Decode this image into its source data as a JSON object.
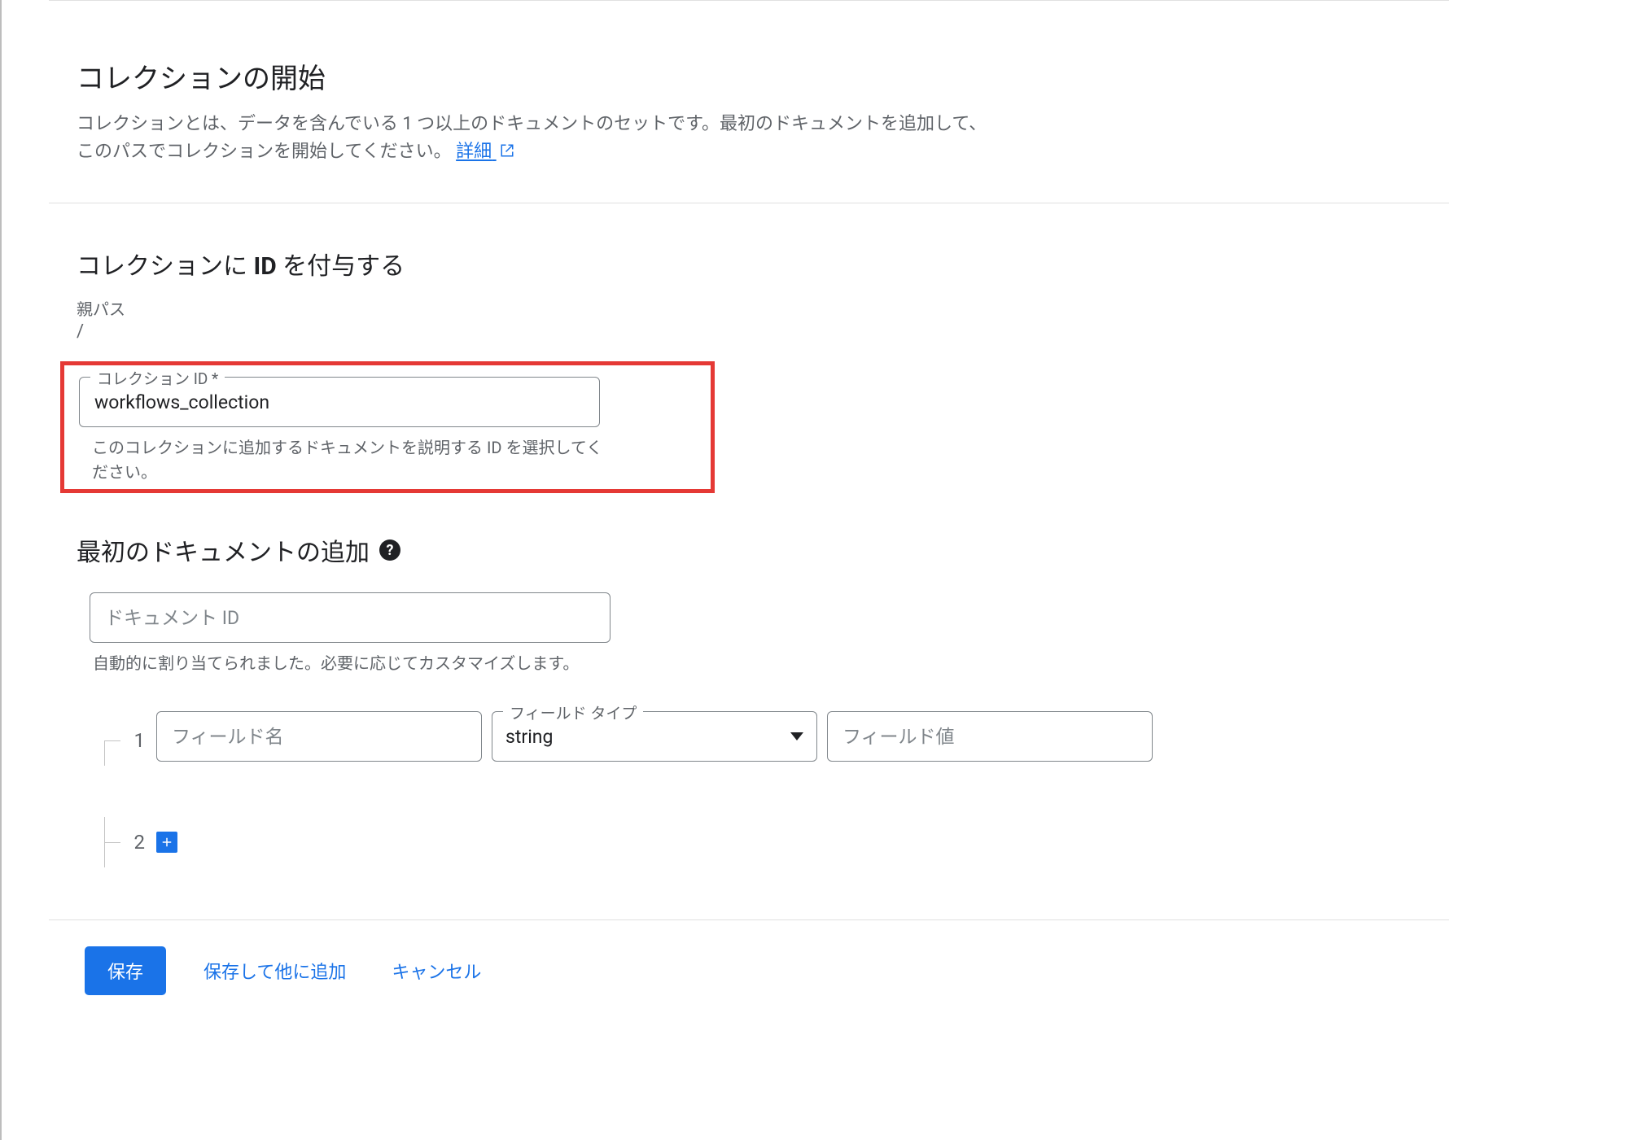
{
  "header": {
    "title": "コレクションの開始",
    "desc_prefix": "コレクションとは、データを含んでいる 1 つ以上のドキュメントのセットです。最初のドキュメントを追加して、このパスでコレクションを開始してください。",
    "learn_more": "詳細"
  },
  "assign_id": {
    "title_prefix": "コレクションに ",
    "title_bold": "ID",
    "title_suffix": " を付与する",
    "parent_path_label": "親パス",
    "parent_path_value": "/",
    "collection_id_label": "コレクション ID *",
    "collection_id_value": "workflows_collection",
    "collection_id_helper": "このコレクションに追加するドキュメントを説明する ID を選択してください。"
  },
  "first_doc": {
    "title": "最初のドキュメントの追加",
    "doc_id_placeholder": "ドキュメント ID",
    "doc_id_helper": "自動的に割り当てられました。必要に応じてカスタマイズします。"
  },
  "field_row": {
    "index1": "1",
    "index2": "2",
    "field_name_placeholder": "フィールド名",
    "field_type_label": "フィールド タイプ",
    "field_type_value": "string",
    "field_value_placeholder": "フィールド値"
  },
  "actions": {
    "save": "保存",
    "save_add": "保存して他に追加",
    "cancel": "キャンセル"
  }
}
